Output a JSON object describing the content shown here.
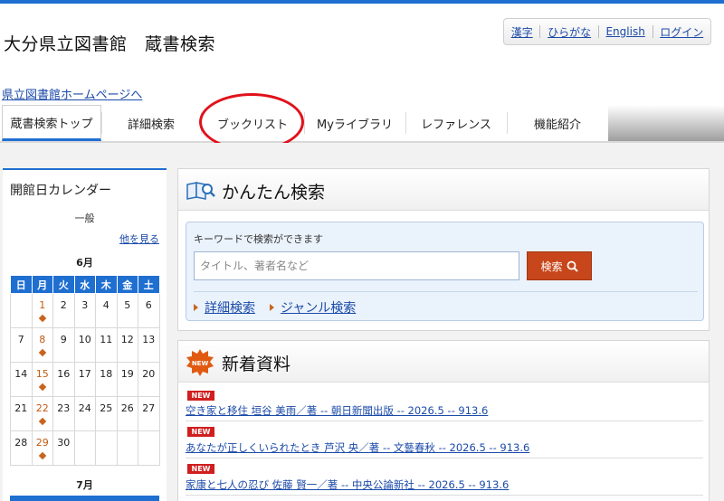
{
  "site": {
    "title": "大分県立図書館　蔵書検索",
    "home_link": "県立図書館ホームページへ"
  },
  "lang_links": [
    "漢字",
    "ひらがな",
    "English",
    "ログイン"
  ],
  "tabs": [
    {
      "label": "蔵書検索トップ"
    },
    {
      "label": "詳細検索"
    },
    {
      "label": "ブックリスト"
    },
    {
      "label": "Myライブラリ"
    },
    {
      "label": "レファレンス"
    },
    {
      "label": "機能紹介"
    }
  ],
  "calendar": {
    "title": "開館日カレンダー",
    "subtitle": "一般",
    "more_link": "他を見る",
    "month": "6月",
    "next_month": "7月",
    "weekdays": [
      "日",
      "月",
      "火",
      "水",
      "木",
      "金",
      "土"
    ],
    "weeks": [
      [
        "",
        "1",
        "2",
        "3",
        "4",
        "5",
        "6"
      ],
      [
        "7",
        "8",
        "9",
        "10",
        "11",
        "12",
        "13"
      ],
      [
        "14",
        "15",
        "16",
        "17",
        "18",
        "19",
        "20"
      ],
      [
        "21",
        "22",
        "23",
        "24",
        "25",
        "26",
        "27"
      ],
      [
        "28",
        "29",
        "30",
        "",
        "",
        "",
        ""
      ]
    ],
    "open_days": [
      "1",
      "8",
      "15",
      "22",
      "29"
    ],
    "colors": {
      "header": "#1f6fd1",
      "open_marker": "#c8641e"
    }
  },
  "simple_search": {
    "title": "かんたん検索",
    "hint": "キーワードで検索ができます",
    "placeholder": "タイトル、著者名など",
    "button": "検索",
    "links": [
      "詳細検索",
      "ジャンル検索"
    ]
  },
  "new_materials": {
    "title": "新着資料",
    "badge_icon_label": "NEW",
    "items": [
      {
        "badge": "NEW",
        "text": "空き家と移住 垣谷 美雨／著 -- 朝日新聞出版 -- 2026.5 -- 913.6"
      },
      {
        "badge": "NEW",
        "text": "あなたが正しくいられたとき 芦沢 央／著 -- 文藝春秋 -- 2026.5 -- 913.6"
      },
      {
        "badge": "NEW",
        "text": "家康と七人の忍び 佐藤 賢一／著 -- 中央公論新社 -- 2026.5 -- 913.6"
      }
    ]
  },
  "colors": {
    "accent": "#1f6fd1",
    "search_button": "#c8461b",
    "annotation_circle": "#e0121b",
    "new_badge": "#d11e1e"
  }
}
